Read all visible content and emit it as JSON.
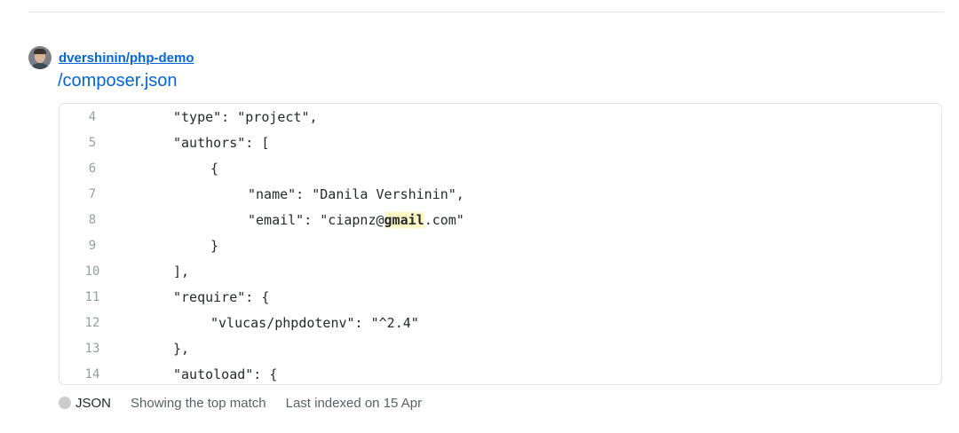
{
  "repo": {
    "name": "dvershinin/php-demo"
  },
  "file": {
    "path": "/composer.json"
  },
  "code_lines": [
    {
      "num": "4",
      "text": "\"type\": \"project\",",
      "indent": 0
    },
    {
      "num": "5",
      "text": "\"authors\": [",
      "indent": 0
    },
    {
      "num": "6",
      "text": "{",
      "indent": 1
    },
    {
      "num": "7",
      "text": "\"name\": \"Danila Vershinin\",",
      "indent": 2
    },
    {
      "num": "8",
      "pre": "\"email\": \"ciapnz@",
      "highlight": "gmail",
      "post": ".com\"",
      "indent": 2
    },
    {
      "num": "9",
      "text": "}",
      "indent": 1
    },
    {
      "num": "10",
      "text": "],",
      "indent": 0
    },
    {
      "num": "11",
      "text": "\"require\": {",
      "indent": 0
    },
    {
      "num": "12",
      "text": "\"vlucas/phpdotenv\": \"^2.4\"",
      "indent": 1
    },
    {
      "num": "13",
      "text": "},",
      "indent": 0
    },
    {
      "num": "14",
      "text": "\"autoload\": {",
      "indent": 0
    }
  ],
  "footer": {
    "language": "JSON",
    "language_color": "#cccccc",
    "match_text": "Showing the top match",
    "indexed_text": "Last indexed on 15 Apr"
  },
  "icons": {
    "avatar": "user-avatar",
    "language_dot": "language-color-dot"
  }
}
